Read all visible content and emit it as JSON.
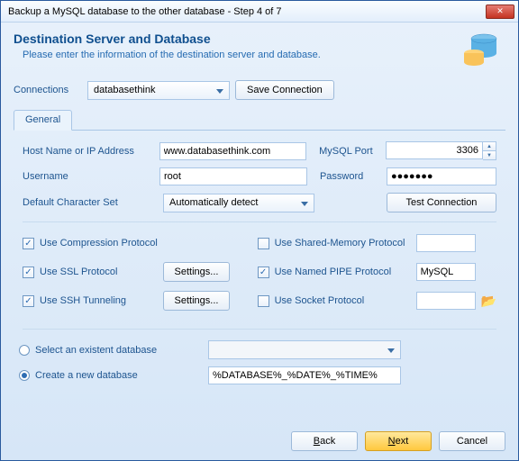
{
  "titlebar": "Backup a MySQL database to the other database - Step 4 of 7",
  "header": {
    "title": "Destination Server and Database",
    "subtitle": "Please enter the information of the destination server and database."
  },
  "connections": {
    "label": "Connections",
    "selected": "databasethink",
    "save_btn": "Save Connection"
  },
  "tab_general": "General",
  "form": {
    "host_label": "Host Name or IP Address",
    "host_value": "www.databasethink.com",
    "port_label": "MySQL Port",
    "port_value": "3306",
    "user_label": "Username",
    "user_value": "root",
    "pass_label": "Password",
    "pass_value": "●●●●●●●",
    "charset_label": "Default Character Set",
    "charset_value": "Automatically detect",
    "test_btn": "Test Connection"
  },
  "protocols": {
    "compression": "Use Compression Protocol",
    "ssl": "Use SSL Protocol",
    "ssh": "Use SSH Tunneling",
    "shared_mem": "Use Shared-Memory Protocol",
    "named_pipe": "Use Named PIPE Protocol",
    "socket": "Use Socket Protocol",
    "settings_btn": "Settings...",
    "named_pipe_value": "MySQL"
  },
  "database": {
    "select_label": "Select an existent database",
    "create_label": "Create a new database",
    "create_value": "%DATABASE%_%DATE%_%TIME%"
  },
  "footer": {
    "back": "Back",
    "next": "Next",
    "cancel": "Cancel"
  }
}
